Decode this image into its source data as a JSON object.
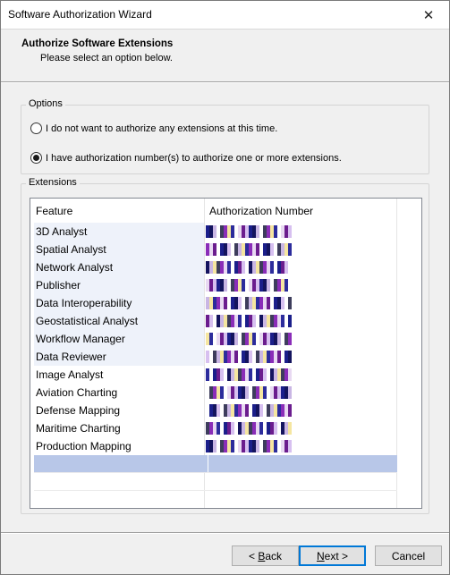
{
  "window": {
    "title": "Software Authorization Wizard",
    "close_glyph": "✕"
  },
  "header": {
    "title": "Authorize Software Extensions",
    "subtitle": "Please select an option below."
  },
  "options": {
    "legend": "Options",
    "choices": [
      {
        "label": "I do not want to authorize any extensions at this time.",
        "checked": false
      },
      {
        "label": "I have authorization number(s) to authorize one or more extensions.",
        "checked": true
      }
    ]
  },
  "extensions": {
    "legend": "Extensions",
    "columns": [
      "Feature",
      "Authorization Number"
    ],
    "rows": [
      {
        "feature": "3D Analyst",
        "auth_masked": true
      },
      {
        "feature": "Spatial Analyst",
        "auth_masked": true
      },
      {
        "feature": "Network Analyst",
        "auth_masked": true
      },
      {
        "feature": "Publisher",
        "auth_masked": true
      },
      {
        "feature": "Data Interoperability",
        "auth_masked": true
      },
      {
        "feature": "Geostatistical Analyst",
        "auth_masked": true
      },
      {
        "feature": "Workflow Manager",
        "auth_masked": true
      },
      {
        "feature": "Data Reviewer",
        "auth_masked": true
      },
      {
        "feature": "Image Analyst",
        "auth_masked": true
      },
      {
        "feature": "Aviation Charting",
        "auth_masked": true
      },
      {
        "feature": "Defense Mapping",
        "auth_masked": true
      },
      {
        "feature": "Maritime Charting",
        "auth_masked": true
      },
      {
        "feature": "Production Mapping",
        "auth_masked": true
      }
    ],
    "selected_row_color": "#b8c7e8"
  },
  "buttons": {
    "back": {
      "prefix": "< ",
      "mnemonic": "B",
      "rest": "ack"
    },
    "next": {
      "mnemonic": "N",
      "rest": "ext >"
    },
    "cancel": "Cancel"
  }
}
